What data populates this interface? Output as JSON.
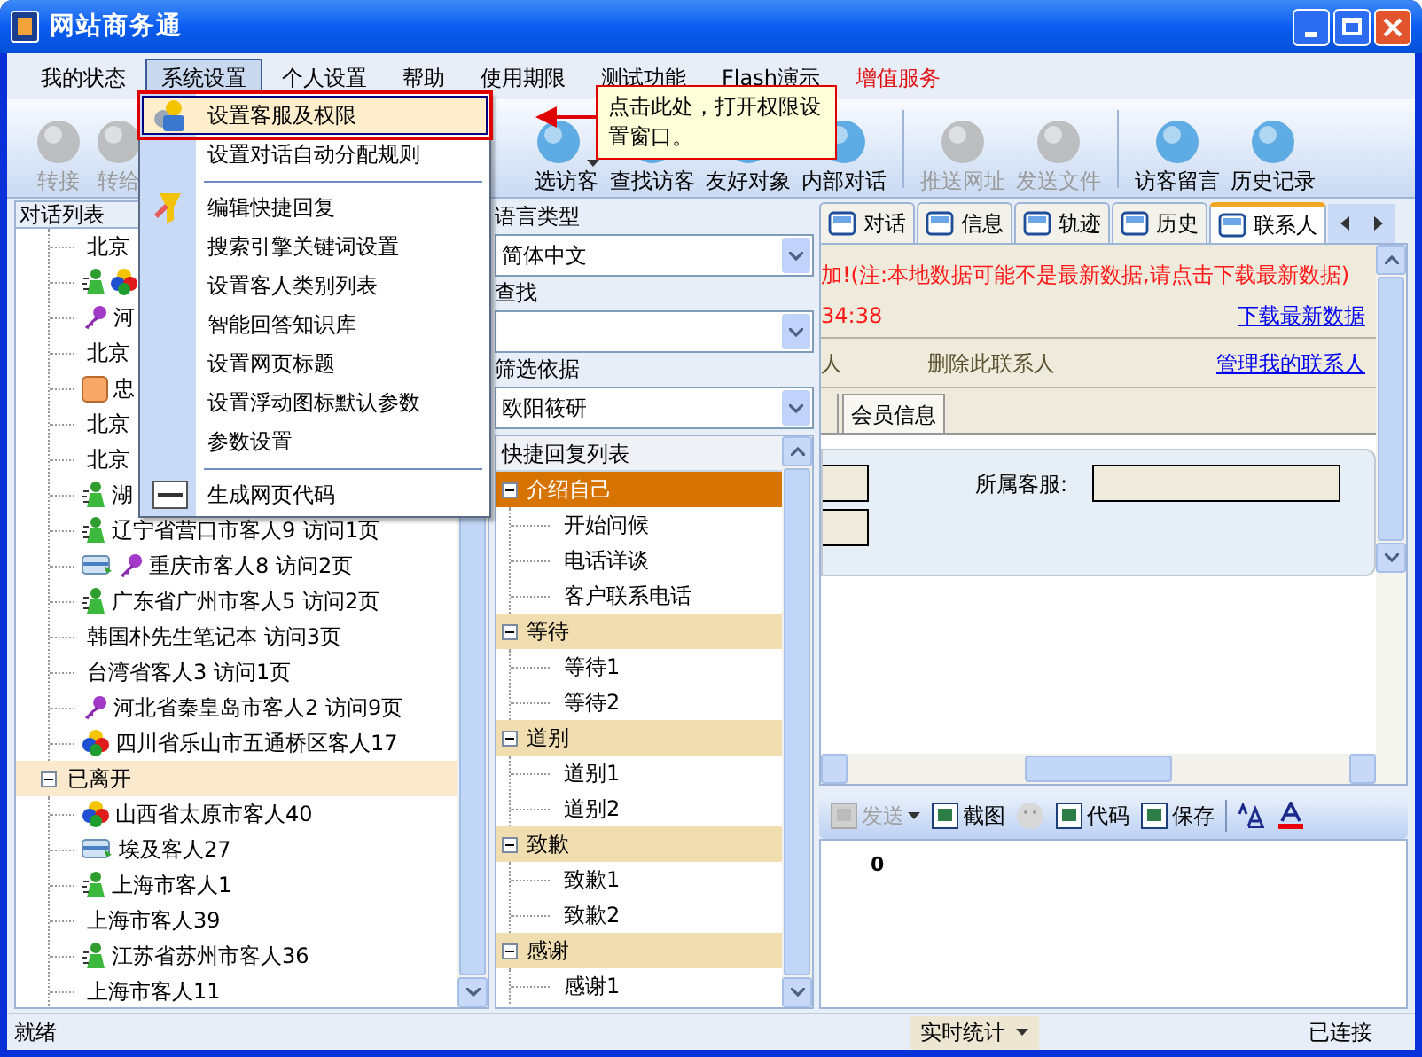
{
  "window": {
    "title": "网站商务通"
  },
  "menu_bar": [
    {
      "label": "我的状态",
      "selected": false,
      "kind": "normal"
    },
    {
      "label": "系统设置",
      "selected": true,
      "kind": "normal"
    },
    {
      "label": "个人设置",
      "selected": false,
      "kind": "normal"
    },
    {
      "label": "帮助",
      "selected": false,
      "kind": "normal"
    },
    {
      "label": "使用期限",
      "selected": false,
      "kind": "normal"
    },
    {
      "label": "测试功能",
      "selected": false,
      "kind": "normal"
    },
    {
      "label": "Flash演示",
      "selected": false,
      "kind": "normal"
    },
    {
      "label": "增值服务",
      "selected": false,
      "kind": "promo"
    }
  ],
  "toolbar": {
    "left": [
      {
        "label": "转接",
        "disabled": true,
        "dropdown": false
      },
      {
        "label": "转给",
        "disabled": true,
        "dropdown": false
      }
    ],
    "right": [
      {
        "label": "选访客",
        "disabled": false,
        "dropdown": true
      },
      {
        "label": "查找访客",
        "disabled": false,
        "dropdown": false
      },
      {
        "label": "友好对象",
        "disabled": false,
        "dropdown": false
      },
      {
        "label": "内部对话",
        "disabled": false,
        "dropdown": false
      },
      {
        "label": "推送网址",
        "disabled": true,
        "dropdown": false
      },
      {
        "label": "发送文件",
        "disabled": true,
        "dropdown": false
      },
      {
        "label": "访客留言",
        "disabled": false,
        "dropdown": false
      },
      {
        "label": "历史记录",
        "disabled": false,
        "dropdown": false
      }
    ]
  },
  "system_menu": {
    "items": [
      {
        "kind": "item",
        "label": "设置客服及权限",
        "selected": true
      },
      {
        "kind": "item",
        "label": "设置对话自动分配规则",
        "selected": false
      },
      {
        "kind": "separator"
      },
      {
        "kind": "item",
        "label": "编辑快捷回复",
        "selected": false
      },
      {
        "kind": "item",
        "label": "搜索引擎关键词设置",
        "selected": false
      },
      {
        "kind": "item",
        "label": "设置客人类别列表",
        "selected": false
      },
      {
        "kind": "item",
        "label": "智能回答知识库",
        "selected": false
      },
      {
        "kind": "item",
        "label": "设置网页标题",
        "selected": false
      },
      {
        "kind": "item",
        "label": "设置浮动图标默认参数",
        "selected": false
      },
      {
        "kind": "item",
        "label": "参数设置",
        "selected": false
      },
      {
        "kind": "separator"
      },
      {
        "kind": "item",
        "label": "生成网页代码",
        "selected": false
      }
    ]
  },
  "callout": {
    "text": "点击此处，打开权限设置窗口。"
  },
  "conversation_list": {
    "title": "对话列表",
    "groups": [
      {
        "expanded": true,
        "children": [
          {
            "label": "北京",
            "kind": "none"
          },
          {
            "kind": "person_colorful"
          },
          {
            "label": "河",
            "kind": "key"
          },
          {
            "label": "北京",
            "kind": "none"
          },
          {
            "label": "忠",
            "kind": "tag"
          },
          {
            "label": "北京",
            "kind": "none"
          },
          {
            "label": "北京",
            "kind": "none"
          },
          {
            "label": "湖",
            "kind": "person"
          },
          {
            "label": "辽宁省营口市客人9 访问1页",
            "kind": "person"
          },
          {
            "label": "重庆市客人8 访问2页",
            "kind": "card_key"
          },
          {
            "label": "广东省广州市客人5 访问2页",
            "kind": "person"
          },
          {
            "label": "韩国朴先生笔记本 访问3页",
            "kind": "none"
          },
          {
            "label": "台湾省客人3 访问1页",
            "kind": "none"
          },
          {
            "label": "河北省秦皇岛市客人2 访问9页",
            "kind": "key"
          },
          {
            "label": "四川省乐山市五通桥区客人17",
            "kind": "colorful"
          }
        ]
      },
      {
        "label": "已离开",
        "expanded": true,
        "children": [
          {
            "label": "山西省太原市客人40",
            "kind": "colorful"
          },
          {
            "label": "埃及客人27",
            "kind": "card"
          },
          {
            "label": "上海市客人1",
            "kind": "person"
          },
          {
            "label": "上海市客人39",
            "kind": "none"
          },
          {
            "label": "江苏省苏州市客人36",
            "kind": "person"
          },
          {
            "label": "上海市客人11",
            "kind": "none"
          }
        ]
      }
    ]
  },
  "filters": [
    {
      "label": "语言类型",
      "value": "简体中文"
    },
    {
      "label": "查找"
    },
    {
      "label": "筛选依据",
      "value": "欧阳筱研"
    }
  ],
  "quick_replies": {
    "title": "快捷回复列表",
    "groups": [
      {
        "label": "介绍自己",
        "selected": true,
        "expanded": true,
        "children": [
          {
            "label": "开始问候"
          },
          {
            "label": "电话详谈"
          },
          {
            "label": "客户联系电话"
          }
        ]
      },
      {
        "label": "等待",
        "selected": false,
        "expanded": true,
        "children": [
          {
            "label": "等待1"
          },
          {
            "label": "等待2"
          }
        ]
      },
      {
        "label": "道别",
        "selected": false,
        "expanded": true,
        "children": [
          {
            "label": "道别1"
          },
          {
            "label": "道别2"
          }
        ]
      },
      {
        "label": "致歉",
        "selected": false,
        "expanded": true,
        "children": [
          {
            "label": "致歉1"
          },
          {
            "label": "致歉2"
          }
        ]
      },
      {
        "label": "感谢",
        "selected": false,
        "expanded": true,
        "children": [
          {
            "label": "感谢1"
          }
        ]
      }
    ]
  },
  "tabs": [
    {
      "label": "对话",
      "selected": false
    },
    {
      "label": "信息",
      "selected": false
    },
    {
      "label": "轨迹",
      "selected": false
    },
    {
      "label": "历史",
      "selected": false
    },
    {
      "label": "联系人",
      "selected": true
    }
  ],
  "contact": {
    "notice": "加!(注:本地数据可能不是最新数据,请点击下载最新数据)",
    "time": "34:38",
    "download_link": "下载最新数据",
    "actions": [
      {
        "label": "人",
        "kind": "text"
      },
      {
        "label": "删除此联系人",
        "kind": "text"
      },
      {
        "label": "管理我的联系人",
        "kind": "link"
      }
    ],
    "subtabs": [
      {
        "label": "会员信息",
        "selected": false
      }
    ],
    "fields": [
      {
        "label": "所属客服:"
      }
    ]
  },
  "editor_toolbar": [
    {
      "kind": "button",
      "label": "发送",
      "disabled": true,
      "dropdown": true
    },
    {
      "kind": "button",
      "label": "截图",
      "disabled": false,
      "dropdown": false
    },
    {
      "kind": "smiley"
    },
    {
      "kind": "button",
      "label": "代码",
      "disabled": false,
      "dropdown": false
    },
    {
      "kind": "button",
      "label": "保存",
      "disabled": false,
      "dropdown": false
    },
    {
      "kind": "separator"
    },
    {
      "kind": "font_size"
    },
    {
      "kind": "font_color"
    }
  ],
  "message_input": {
    "value": "0"
  },
  "status_bar": {
    "status": "就绪",
    "stats_button": "实时统计",
    "connection": "已连接"
  }
}
